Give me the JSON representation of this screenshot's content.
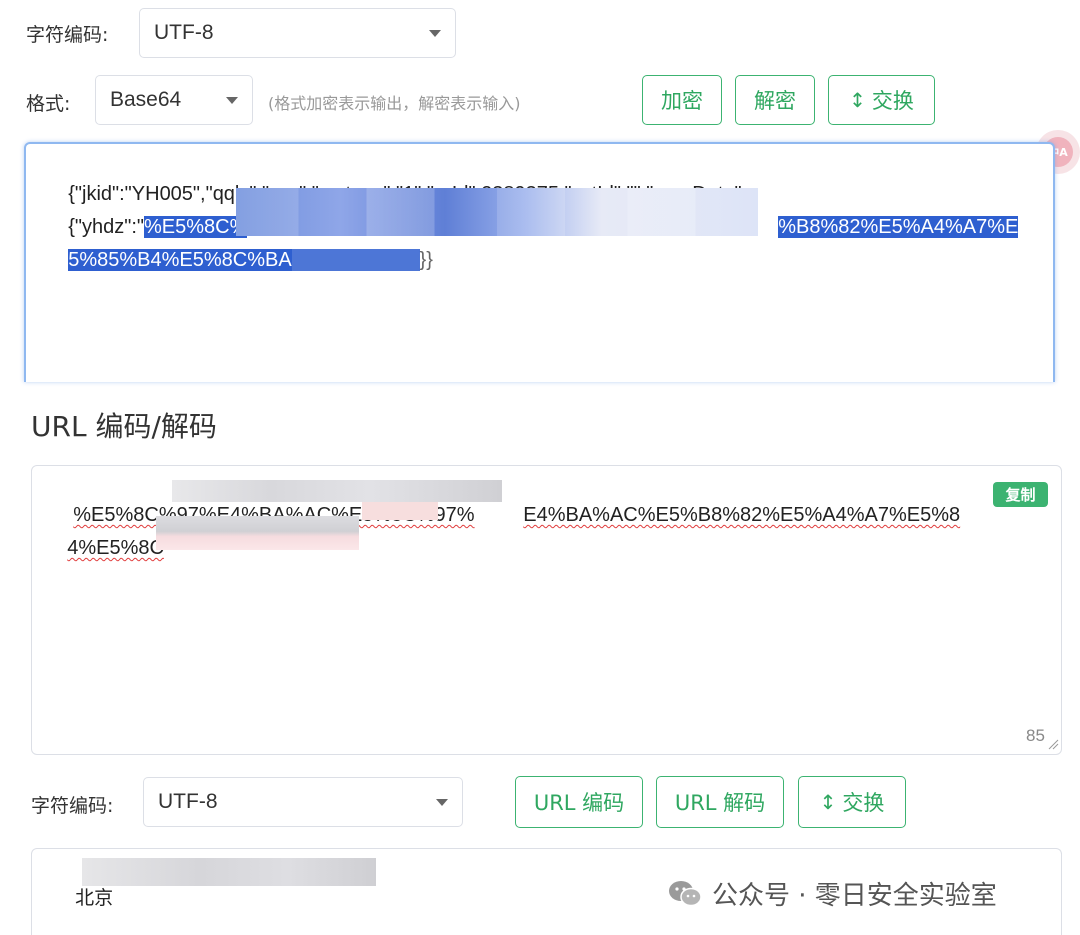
{
  "top": {
    "charset_label": "字符编码:",
    "charset_value": "UTF-8",
    "format_label": "格式:",
    "format_value": "Base64",
    "format_hint": "(格式加密表示输出，解密表示输入)",
    "encrypt_button": "加密",
    "decrypt_button": "解密",
    "swap_button": "交换"
  },
  "input_area": {
    "line1": "{\"jkid\":\"YH005\",\"qqly\":\"xcx\",\"smtype\":\"1\",\"grId\":2389375,\"yctId\":\"\",\"userData\":",
    "line2_prefix": "{\"yhdz\":\"",
    "line2_sel_start": "%E5%8C%",
    "line2_sel_end": "%B8%82%E5%A4%A7%E",
    "line3_sel": "5%85%B4%E5%8C%BA",
    "line3_tail": "}}"
  },
  "url_section": {
    "title": "URL 编码/解码",
    "line1_start": "%E5%8C%97%E4%BA%AC%E5%8C%97%",
    "line1_end": "E4%BA%AC%E5%B8%82%E5%A4%A7%E5%8",
    "line2_start": "4%E5%8C",
    "copy_badge": "复制",
    "char_count": "85",
    "charset_label": "字符编码:",
    "charset_value": "UTF-8",
    "url_encode_button": "URL 编码",
    "url_decode_button": "URL 解码",
    "swap_button": "交换"
  },
  "output_area": {
    "text_start": "北京"
  },
  "translate_icon": {
    "label": "中A"
  },
  "watermark": {
    "text": "公众号 · 零日安全实验室"
  },
  "colors": {
    "accent": "#3cb371",
    "selection": "#2e5fd0",
    "focus_border": "#8fb8f0"
  }
}
